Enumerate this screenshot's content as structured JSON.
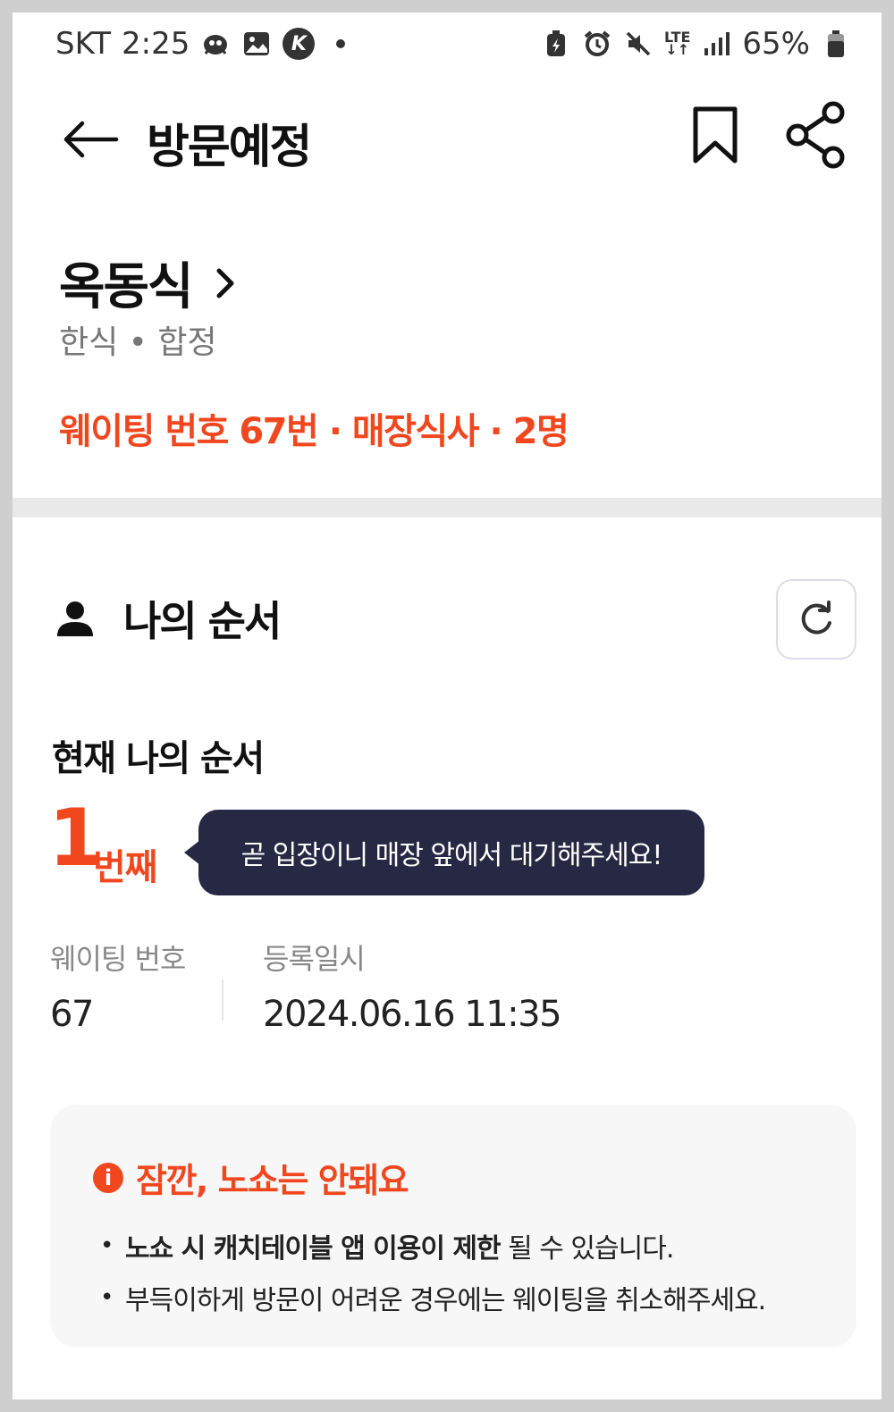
{
  "status_bar": {
    "carrier": "SKT",
    "time": "2:25",
    "network": "LTE",
    "battery": "65%"
  },
  "header": {
    "title": "방문예정"
  },
  "restaurant": {
    "name": "옥동식",
    "category": "한식 • 합정",
    "waiting_summary": "웨이팅 번호 67번 · 매장식사 · 2명"
  },
  "my_order": {
    "section_title": "나의 순서",
    "current_label": "현재 나의 순서",
    "position": "1",
    "position_unit": "번째",
    "tooltip": "곧 입장이니 매장 앞에서 대기해주세요!",
    "waiting_number_label": "웨이팅 번호",
    "waiting_number": "67",
    "registered_label": "등록일시",
    "registered_at": "2024.06.16 11:35"
  },
  "notice": {
    "title": "잠깐, 노쇼는 안돼요",
    "items": [
      {
        "bold": "노쇼 시 캐치테이블 앱 이용이 제한",
        "rest": " 될 수 있습니다."
      },
      {
        "bold": "",
        "rest": "부득이하게 방문이 어려운 경우에는 웨이팅을 취소해주세요."
      }
    ]
  },
  "colors": {
    "accent": "#f1471f",
    "tooltip_bg": "#272944"
  }
}
